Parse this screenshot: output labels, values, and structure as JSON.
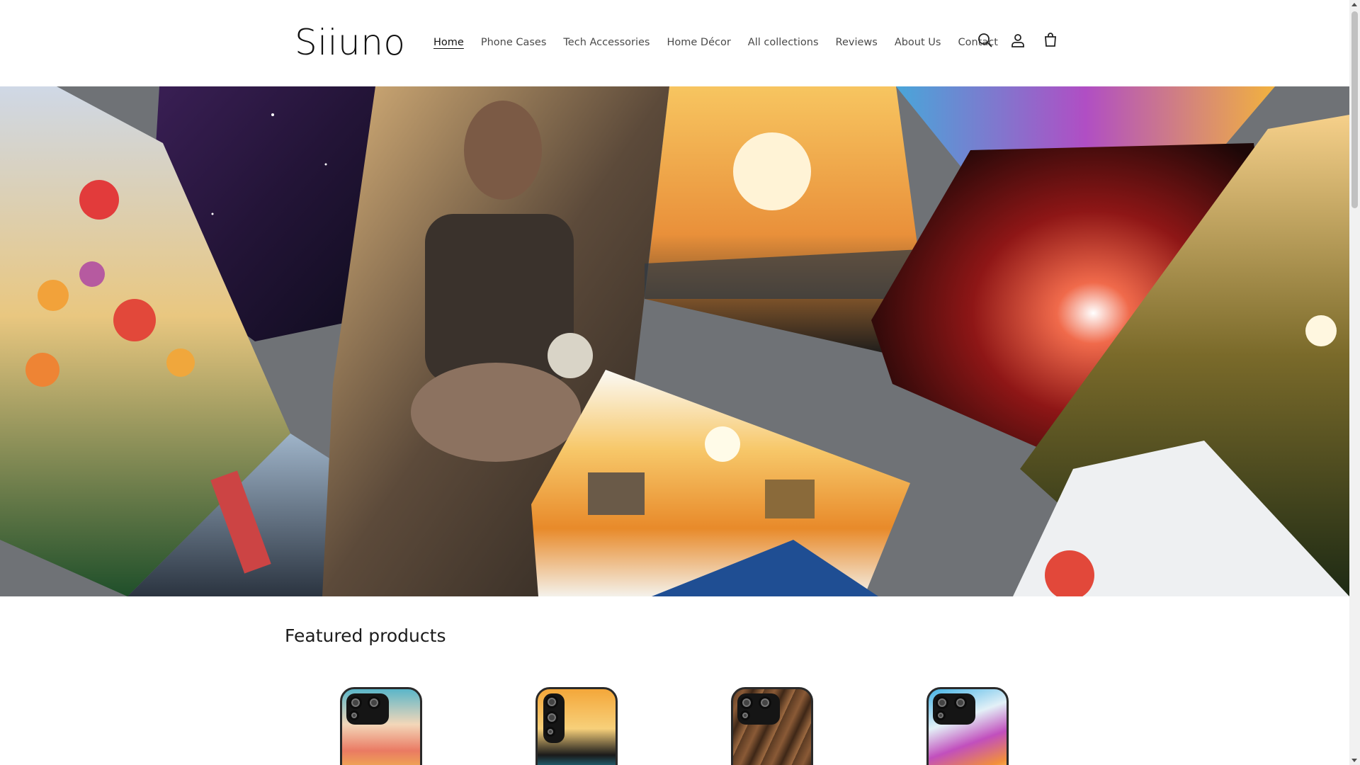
{
  "header": {
    "logo": "Siiuno",
    "nav": [
      {
        "label": "Home",
        "active": true
      },
      {
        "label": "Phone Cases",
        "active": false
      },
      {
        "label": "Tech Accessories",
        "active": false
      },
      {
        "label": "Home Décor",
        "active": false
      },
      {
        "label": "All collections",
        "active": false
      },
      {
        "label": "Reviews",
        "active": false
      },
      {
        "label": "About Us",
        "active": false
      },
      {
        "label": "Contact",
        "active": false
      }
    ],
    "icons": [
      "search-icon",
      "account-icon",
      "cart-icon"
    ]
  },
  "hero": {
    "description_icons": [
      "tulips-art",
      "galaxy-art",
      "biker-art",
      "sunset-beach-art",
      "paint-drip-art",
      "city-street-art",
      "watercolor-village-art",
      "red-nebula-art",
      "lake-reflection-art"
    ]
  },
  "featured": {
    "title": "Featured products",
    "products": [
      {
        "name": "watercolor-case"
      },
      {
        "name": "palm-sunset-case"
      },
      {
        "name": "wood-grain-case"
      },
      {
        "name": "paint-drip-case"
      }
    ]
  }
}
